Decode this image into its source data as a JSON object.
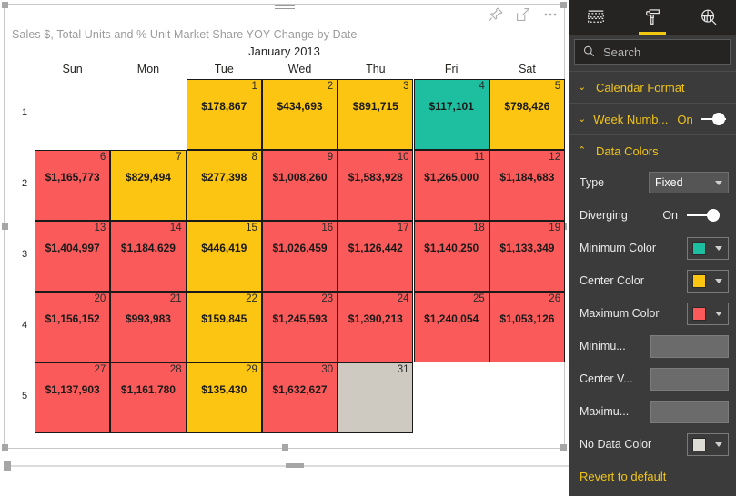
{
  "visual": {
    "title": "Sales $, Total Units and % Unit Market Share YOY Change by Date",
    "month_label": "January 2013",
    "actions": [
      {
        "name": "pin-icon",
        "label": "Pin to dashboard"
      },
      {
        "name": "focus-mode-icon",
        "label": "Focus mode"
      },
      {
        "name": "more-options-icon",
        "label": "More options"
      }
    ]
  },
  "calendar": {
    "day_headers": [
      "Sun",
      "Mon",
      "Tue",
      "Wed",
      "Thu",
      "Fri",
      "Sat"
    ],
    "week_numbers": [
      "1",
      "2",
      "3",
      "4",
      "5"
    ],
    "colors": {
      "minimum": "#1DBFA0",
      "center": "#FCC511",
      "maximum": "#FB5A5A",
      "no_data": "#CECAC2",
      "cell_border": "#1a1a1a"
    },
    "weeks": [
      {
        "week": "1",
        "days": [
          {
            "day": "",
            "value": "",
            "color": ""
          },
          {
            "day": "",
            "value": "",
            "color": ""
          },
          {
            "day": "1",
            "value": "$178,867",
            "color": "#FCC511"
          },
          {
            "day": "2",
            "value": "$434,693",
            "color": "#FCC511"
          },
          {
            "day": "3",
            "value": "$891,715",
            "color": "#FCC511"
          },
          {
            "day": "4",
            "value": "$117,101",
            "color": "#1DBFA0"
          },
          {
            "day": "5",
            "value": "$798,426",
            "color": "#FCC511"
          }
        ]
      },
      {
        "week": "2",
        "days": [
          {
            "day": "6",
            "value": "$1,165,773",
            "color": "#FB5A5A"
          },
          {
            "day": "7",
            "value": "$829,494",
            "color": "#FCC511"
          },
          {
            "day": "8",
            "value": "$277,398",
            "color": "#FCC511"
          },
          {
            "day": "9",
            "value": "$1,008,260",
            "color": "#FB5A5A"
          },
          {
            "day": "10",
            "value": "$1,583,928",
            "color": "#FB5A5A"
          },
          {
            "day": "11",
            "value": "$1,265,000",
            "color": "#FB5A5A"
          },
          {
            "day": "12",
            "value": "$1,184,683",
            "color": "#FB5A5A"
          }
        ]
      },
      {
        "week": "3",
        "days": [
          {
            "day": "13",
            "value": "$1,404,997",
            "color": "#FB5A5A"
          },
          {
            "day": "14",
            "value": "$1,184,629",
            "color": "#FB5A5A"
          },
          {
            "day": "15",
            "value": "$446,419",
            "color": "#FCC511"
          },
          {
            "day": "16",
            "value": "$1,026,459",
            "color": "#FB5A5A"
          },
          {
            "day": "17",
            "value": "$1,126,442",
            "color": "#FB5A5A"
          },
          {
            "day": "18",
            "value": "$1,140,250",
            "color": "#FB5A5A"
          },
          {
            "day": "19",
            "value": "$1,133,349",
            "color": "#FB5A5A"
          }
        ]
      },
      {
        "week": "4",
        "days": [
          {
            "day": "20",
            "value": "$1,156,152",
            "color": "#FB5A5A"
          },
          {
            "day": "21",
            "value": "$993,983",
            "color": "#FB5A5A"
          },
          {
            "day": "22",
            "value": "$159,845",
            "color": "#FCC511"
          },
          {
            "day": "23",
            "value": "$1,245,593",
            "color": "#FB5A5A"
          },
          {
            "day": "24",
            "value": "$1,390,213",
            "color": "#FB5A5A"
          },
          {
            "day": "25",
            "value": "$1,240,054",
            "color": "#FB5A5A"
          },
          {
            "day": "26",
            "value": "$1,053,126",
            "color": "#FB5A5A"
          }
        ]
      },
      {
        "week": "5",
        "days": [
          {
            "day": "27",
            "value": "$1,137,903",
            "color": "#FB5A5A"
          },
          {
            "day": "28",
            "value": "$1,161,780",
            "color": "#FB5A5A"
          },
          {
            "day": "29",
            "value": "$135,430",
            "color": "#FCC511"
          },
          {
            "day": "30",
            "value": "$1,632,627",
            "color": "#FB5A5A"
          },
          {
            "day": "31",
            "value": "",
            "color": "#CECAC2"
          },
          {
            "day": "",
            "value": "",
            "color": ""
          },
          {
            "day": "",
            "value": "",
            "color": ""
          }
        ]
      }
    ]
  },
  "pane": {
    "tabs": [
      {
        "name": "fields-tab",
        "label": "Fields",
        "icon": "fields-icon",
        "active": false
      },
      {
        "name": "format-tab",
        "label": "Format",
        "icon": "paint-roller-icon",
        "active": true
      },
      {
        "name": "analytics-tab",
        "label": "Analytics",
        "icon": "analytics-magnifier-icon",
        "active": false
      }
    ],
    "search": {
      "placeholder": "Search",
      "value": ""
    },
    "sections": [
      {
        "name": "calendar-format",
        "title": "Calendar Format",
        "expanded": false,
        "chevron": "⌄"
      },
      {
        "name": "week-number",
        "title": "Week Numb...",
        "expanded": false,
        "chevron": "⌄",
        "state": "On"
      },
      {
        "name": "data-colors",
        "title": "Data Colors",
        "expanded": true,
        "chevron": "⌃"
      }
    ],
    "data_colors": {
      "type_label": "Type",
      "type_value": "Fixed",
      "diverging_label": "Diverging",
      "diverging_state": "On",
      "minimum_color_label": "Minimum Color",
      "minimum_color": "#1DBFA0",
      "center_color_label": "Center Color",
      "center_color": "#FCC511",
      "maximum_color_label": "Maximum Color",
      "maximum_color": "#FB5A5A",
      "minimum_value_label": "Minimu...",
      "minimum_value": "",
      "center_value_label": "Center V...",
      "center_value": "",
      "maximum_value_label": "Maximu...",
      "maximum_value": "",
      "no_data_color_label": "No Data Color",
      "no_data_color": "#DDDDD5",
      "revert_label": "Revert to default"
    },
    "accent_color": "#f0c419"
  }
}
